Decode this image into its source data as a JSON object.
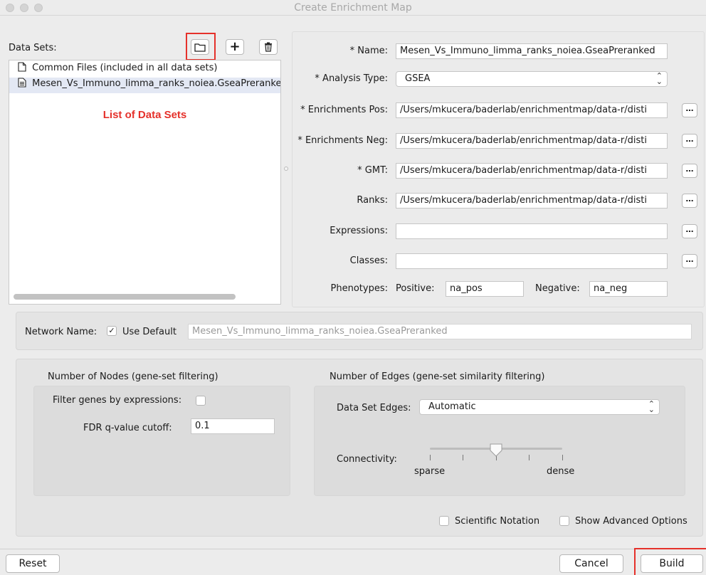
{
  "window": {
    "title": "Create Enrichment Map"
  },
  "data_sets": {
    "label": "Data Sets:",
    "items": [
      {
        "label": "Common Files (included in all data sets)",
        "icon": "file-icon"
      },
      {
        "label": "Mesen_Vs_Immuno_limma_ranks_noiea.GseaPreranked",
        "icon": "document-icon"
      }
    ],
    "annotation": "List of Data Sets"
  },
  "form": {
    "name_label": "* Name:",
    "name_value": "Mesen_Vs_Immuno_limma_ranks_noiea.GseaPreranked",
    "analysis_type_label": "* Analysis Type:",
    "analysis_type_value": "GSEA",
    "enrichments_pos_label": "* Enrichments Pos:",
    "enrichments_pos_value": "/Users/mkucera/baderlab/enrichmentmap/data-r/disti",
    "enrichments_neg_label": "* Enrichments Neg:",
    "enrichments_neg_value": "/Users/mkucera/baderlab/enrichmentmap/data-r/disti",
    "gmt_label": "* GMT:",
    "gmt_value": "/Users/mkucera/baderlab/enrichmentmap/data-r/disti",
    "ranks_label": "Ranks:",
    "ranks_value": "/Users/mkucera/baderlab/enrichmentmap/data-r/disti",
    "expressions_label": "Expressions:",
    "expressions_value": "",
    "classes_label": "Classes:",
    "classes_value": "",
    "phenotypes_label": "Phenotypes:",
    "positive_label": "Positive:",
    "positive_value": "na_pos",
    "negative_label": "Negative:",
    "negative_value": "na_neg",
    "browse_label": "…"
  },
  "network": {
    "label": "Network Name:",
    "use_default_label": "Use Default",
    "use_default_checked": "✓",
    "name_value": "Mesen_Vs_Immuno_limma_ranks_noiea.GseaPreranked"
  },
  "nodes": {
    "title": "Number of Nodes (gene-set filtering)",
    "filter_label": "Filter genes by expressions:",
    "fdr_label": "FDR q-value cutoff:",
    "fdr_value": "0.1"
  },
  "edges": {
    "title": "Number of Edges (gene-set similarity filtering)",
    "data_set_edges_label": "Data Set Edges:",
    "data_set_edges_value": "Automatic",
    "connectivity_label": "Connectivity:",
    "sparse_label": "sparse",
    "dense_label": "dense",
    "slider_position": 0.5
  },
  "options": {
    "scientific_notation_label": "Scientific Notation",
    "advanced_options_label": "Show Advanced Options"
  },
  "buttons": {
    "reset": "Reset",
    "cancel": "Cancel",
    "build": "Build"
  },
  "colors": {
    "highlight": "#e5312b",
    "annotation_text": "#e5312b",
    "selection": "#e3e8f4"
  }
}
